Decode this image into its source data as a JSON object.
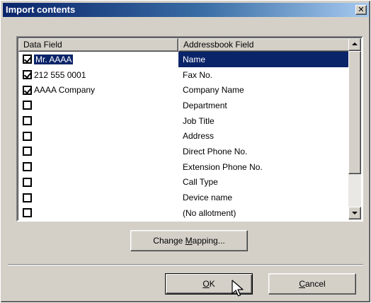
{
  "window": {
    "title": "Import contents",
    "close_glyph": "✕"
  },
  "list": {
    "columns": [
      "Data Field",
      "Addressbook Field"
    ],
    "rows": [
      {
        "checked": true,
        "data": "Mr. AAAA",
        "field": "Name",
        "selected": true
      },
      {
        "checked": true,
        "data": "212 555 0001",
        "field": "Fax No."
      },
      {
        "checked": true,
        "data": "AAAA Company",
        "field": "Company Name"
      },
      {
        "checked": false,
        "data": "",
        "field": "Department"
      },
      {
        "checked": false,
        "data": "",
        "field": "Job Title"
      },
      {
        "checked": false,
        "data": "",
        "field": "Address"
      },
      {
        "checked": false,
        "data": "",
        "field": "Direct Phone No."
      },
      {
        "checked": false,
        "data": "",
        "field": "Extension Phone No."
      },
      {
        "checked": false,
        "data": "",
        "field": "Call Type"
      },
      {
        "checked": false,
        "data": "",
        "field": "Device name"
      },
      {
        "checked": false,
        "data": "",
        "field": "(No allotment)"
      }
    ]
  },
  "buttons": {
    "change_mapping": {
      "pre": "Change ",
      "mnemonic": "M",
      "post": "apping..."
    },
    "ok": {
      "pre": "",
      "mnemonic": "O",
      "post": "K"
    },
    "cancel": {
      "pre": "",
      "mnemonic": "C",
      "post": "ancel"
    }
  },
  "colors": {
    "title_bar_start": "#0a246a",
    "title_bar_end": "#a6caf0",
    "face": "#d4d0c8",
    "selection": "#0a246a"
  },
  "icons": [
    "close-icon",
    "checkbox-icon",
    "scroll-up-icon",
    "scroll-down-icon",
    "mouse-pointer-icon"
  ]
}
